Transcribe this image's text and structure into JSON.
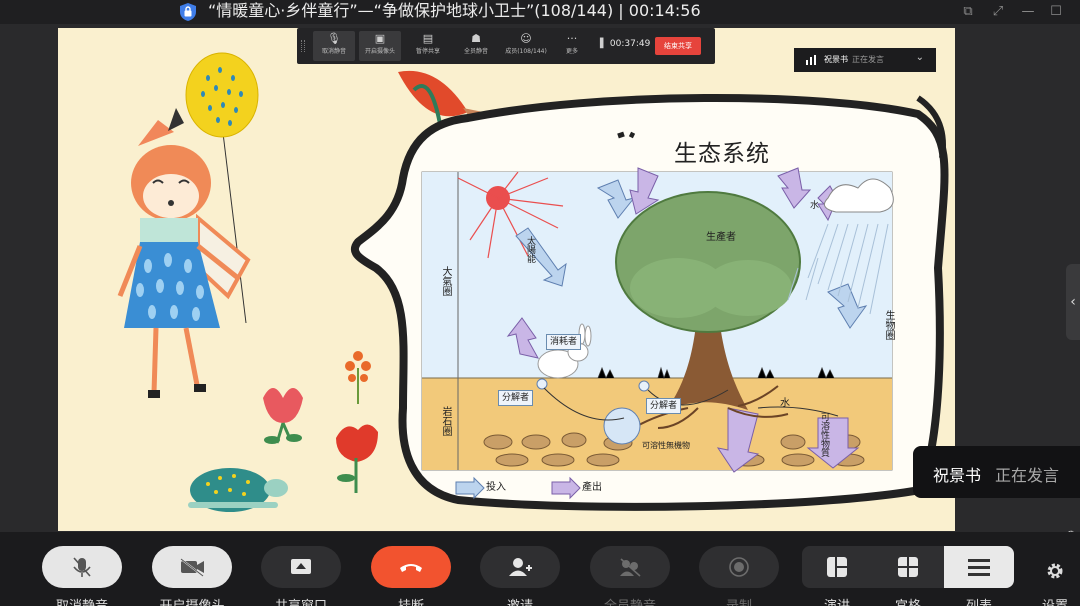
{
  "titlebar": {
    "title": "“情暖童心·乡伴童行”—“争做保护地球小卫士”(108/144)  |  00:14:56"
  },
  "sharebar": {
    "items": [
      {
        "label": "取消静音",
        "icon": "mic-icon"
      },
      {
        "label": "开启摄像头",
        "icon": "camera-icon"
      },
      {
        "label": "暂停共享",
        "icon": "share-pause-icon"
      },
      {
        "label": "全员静音",
        "icon": "mute-all-icon"
      },
      {
        "label": "成员(108/144)",
        "icon": "members-icon"
      },
      {
        "label": "更多",
        "icon": "more-icon"
      }
    ],
    "timer": "00:37:49",
    "end_label": "结束共享"
  },
  "speaker_top": {
    "name": "祝景书",
    "status": "正在发言"
  },
  "speaker_right": {
    "name": "祝景书",
    "status": "正在发言"
  },
  "slide": {
    "title": "生态系统",
    "labels": {
      "atmosphere": "大氣圈",
      "lithosphere": "岩石圈",
      "biosphere": "生物圈",
      "producer": "生產者",
      "consumer": "消耗者",
      "decomposer1": "分解者",
      "decomposer2": "分解者",
      "solar": "太陽能",
      "water": "水",
      "water2": "水",
      "soluble": "可溶性無機物",
      "soluble2": "可溶性物質",
      "legend_in": "投入",
      "legend_out": "產出"
    }
  },
  "controls": {
    "buttons": [
      {
        "label": "取消静音",
        "icon": "mic-off-icon"
      },
      {
        "label": "开启摄像头",
        "icon": "camera-off-icon"
      },
      {
        "label": "共享窗口",
        "icon": "share-screen-icon"
      },
      {
        "label": "挂断",
        "icon": "hangup-icon"
      },
      {
        "label": "邀请",
        "icon": "invite-icon"
      },
      {
        "label": "全员静音",
        "icon": "mute-all-icon"
      },
      {
        "label": "录制",
        "icon": "record-icon"
      }
    ],
    "views": [
      {
        "label": "演讲",
        "icon": "speaker-view-icon"
      },
      {
        "label": "宫格",
        "icon": "grid-view-icon"
      },
      {
        "label": "列表",
        "icon": "list-view-icon"
      }
    ],
    "settings_label": "设置"
  },
  "colors": {
    "hangup": "#f2532f",
    "end_share": "#e6443c",
    "slide_bg": "#faf0cf"
  }
}
